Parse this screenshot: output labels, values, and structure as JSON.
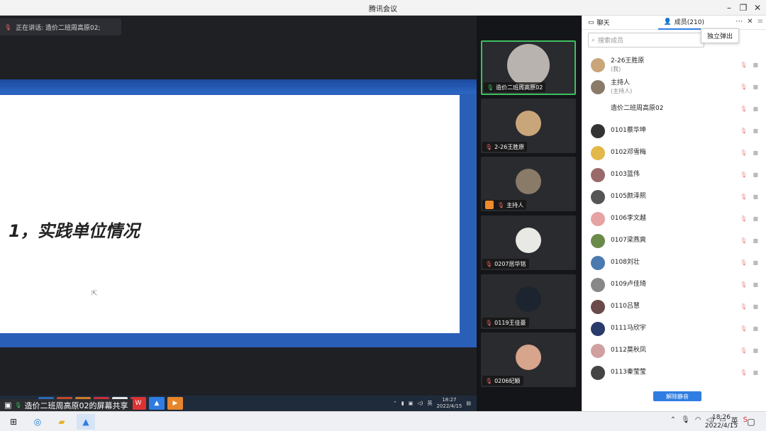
{
  "window": {
    "title": "腾讯会议"
  },
  "share": {
    "speaker_text": "正在讲话: 造价二班周高原02;",
    "slide_heading": "1，实践单位情况",
    "share_label": "造价二班周高原02的屏幕共享",
    "remote_clock_time": "18:27",
    "remote_clock_date": "2022/4/15",
    "remote_ime": "英"
  },
  "tiles": [
    {
      "name": "造价二班周高原02",
      "mic": "on",
      "active": true,
      "color": "#b9b3b0"
    },
    {
      "name": "2-26王胜原",
      "mic": "off",
      "active": false,
      "color": "#c9a57a"
    },
    {
      "name": "主持人",
      "mic": "off",
      "active": false,
      "color": "#8a7a68",
      "host": true
    },
    {
      "name": "0207居华铭",
      "mic": "off",
      "active": false,
      "color": "#e8e8e4"
    },
    {
      "name": "0119王佳豪",
      "mic": "off",
      "active": false,
      "color": "#1c2430"
    },
    {
      "name": "0206纪颖",
      "mic": "off",
      "active": false,
      "color": "#d7a48c"
    }
  ],
  "panel": {
    "tab_chat": "聊天",
    "tab_members": "成员(210)",
    "popout_label": "独立弹出",
    "search_placeholder": "搜索成员",
    "unmute_label": "解除静音",
    "members": [
      {
        "name": "2-26王胜原",
        "sub": "(我)",
        "color": "#c9a57a"
      },
      {
        "name": "主持人",
        "sub": "(主持人)",
        "color": "#8a7a68"
      },
      {
        "name": "造价二班周高原02",
        "sub": "",
        "color": "#ffffff"
      },
      {
        "name": "0101蔡华坤",
        "sub": "",
        "color": "#333333"
      },
      {
        "name": "0102邓雪梅",
        "sub": "",
        "color": "#e3b84a"
      },
      {
        "name": "0103蓝伟",
        "sub": "",
        "color": "#9a6a6a"
      },
      {
        "name": "0105颜泽熙",
        "sub": "",
        "color": "#555555"
      },
      {
        "name": "0106李文越",
        "sub": "",
        "color": "#e6a3a3"
      },
      {
        "name": "0107梁燕爽",
        "sub": "",
        "color": "#6a8a4a"
      },
      {
        "name": "0108刘壮",
        "sub": "",
        "color": "#4a7ab0"
      },
      {
        "name": "0109卢佳琦",
        "sub": "",
        "color": "#888888"
      },
      {
        "name": "0110吕慧",
        "sub": "",
        "color": "#6a4a4a"
      },
      {
        "name": "0111马欣宇",
        "sub": "",
        "color": "#2a3a6a"
      },
      {
        "name": "0112莫秋凤",
        "sub": "",
        "color": "#d0a0a0"
      },
      {
        "name": "0113秦莹莹",
        "sub": "",
        "color": "#444444"
      }
    ]
  },
  "taskbar": {
    "time": "18:26",
    "date": "2022/4/15",
    "ime": "英"
  }
}
